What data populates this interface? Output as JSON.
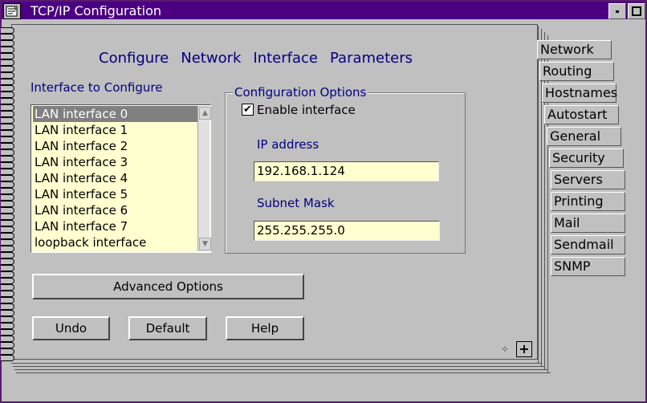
{
  "window": {
    "title": "TCP/IP Configuration"
  },
  "heading": {
    "words": [
      "Configure",
      "Network",
      "Interface",
      "Parameters"
    ]
  },
  "interfaces": {
    "label": "Interface to Configure",
    "items": [
      "LAN interface 0",
      "LAN interface 1",
      "LAN interface 2",
      "LAN interface 3",
      "LAN interface 4",
      "LAN interface 5",
      "LAN interface 6",
      "LAN interface 7",
      "loopback interface"
    ],
    "selected_index": 0
  },
  "options": {
    "group_title": "Configuration Options",
    "enable_label": "Enable interface",
    "enable_checked": true,
    "checkmark": "✔",
    "ip_label": "IP address",
    "ip_value": "192.168.1.124",
    "mask_label": "Subnet Mask",
    "mask_value": "255.255.255.0"
  },
  "buttons": {
    "advanced": "Advanced Options",
    "undo": "Undo",
    "default": "Default",
    "help": "Help"
  },
  "tabs": [
    "Network",
    "Routing",
    "Hostnames",
    "Autostart",
    "General",
    "Security",
    "Servers",
    "Printing",
    "Mail",
    "Sendmail",
    "SNMP"
  ],
  "active_tab": "Network",
  "page_nav": {
    "prev_icon": "arrow-left-icon",
    "next_icon": "plus-icon"
  },
  "colors": {
    "titlebar": "#4b0082",
    "field_bg": "#ffffd0",
    "heading": "#000080"
  }
}
